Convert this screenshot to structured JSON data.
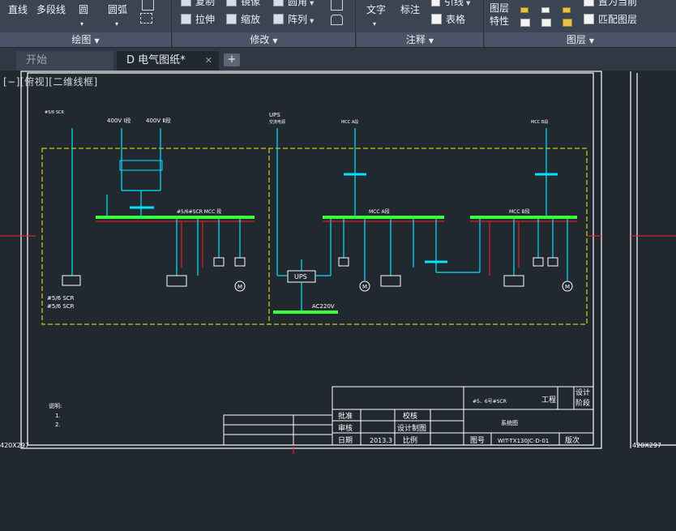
{
  "ribbon": {
    "draw": {
      "title": "绘图",
      "line": "直线",
      "polyline": "多段线",
      "circle": "圆",
      "arc": "圆弧"
    },
    "modify": {
      "title": "修改",
      "copy": "复制",
      "mirror": "镜像",
      "fillet": "圆角",
      "stretch": "拉伸",
      "scale": "缩放",
      "array": "阵列"
    },
    "annotation": {
      "title": "注释",
      "text": "文字",
      "dimension": "标注",
      "leader": "引线",
      "table": "表格"
    },
    "layers": {
      "title": "图层",
      "layer_properties": "图层\n特性",
      "layer_properties_line1": "图层",
      "layer_properties_line2": "特性",
      "make_current": "置为当前",
      "match_layer": "匹配图层"
    }
  },
  "tabs": [
    {
      "label": "开始",
      "active": false
    },
    {
      "label": "D 电气图纸*",
      "active": true
    }
  ],
  "viewport": {
    "label": "[−][俯视][二维线框]"
  },
  "drawing": {
    "paper_size_left": "420X297",
    "paper_size_right": "420X297",
    "feeders": {
      "f1": "#5/6 SCR",
      "f2": "400V Ⅰ段",
      "f3": "400V Ⅱ段",
      "ups": "UPS",
      "ups_sub": "交流电源",
      "mcc_a": "MCC A段",
      "mcc_b": "MCC B段"
    },
    "labels": {
      "bus1": "#5/6#SCR MCC 段",
      "bus2": "MCC A段",
      "bus3": "MCC B段",
      "ups_box": "UPS",
      "ac220": "AC220V",
      "scr_note1": "#5/6 SCR",
      "scr_note2": "#5/6 SCR",
      "motor": "M"
    },
    "notes": {
      "title": "说明:",
      "n1": "1. ",
      "n2": "2. "
    },
    "title_block": {
      "project_title": "#5、6号#SCR",
      "engineering": "工程",
      "design_stage": "设计",
      "stage": "阶段",
      "approve": "批准",
      "review": "审核",
      "date_label": "日期",
      "date_value": "2013.3",
      "check": "校核",
      "design_draw": "设计制图",
      "scale": "比例",
      "drawing_title": "系统图",
      "drawing_no_label": "图号",
      "drawing_no": "WIT-TX130JC-D-01",
      "version": "版次"
    }
  },
  "colors": {
    "background": "#212830",
    "ribbon": "#3b4453",
    "cyan": "#00e5ff",
    "green": "#39ff3a",
    "yellow": "#ffee00",
    "red": "#ff2020",
    "white": "#ffffff"
  },
  "icons": {
    "line": "line-icon",
    "polyline": "polyline-icon",
    "circle": "circle-icon",
    "arc": "arc-icon",
    "copy": "copy-icon",
    "mirror": "mirror-icon",
    "fillet": "fillet-icon",
    "stretch": "stretch-icon",
    "scale": "scale-icon",
    "array": "array-icon",
    "text": "text-icon",
    "dimension": "dimension-icon",
    "leader": "leader-icon",
    "table": "table-icon",
    "layer_properties": "layer-properties-icon",
    "make_current": "make-current-icon",
    "match_layer": "match-layer-icon"
  }
}
